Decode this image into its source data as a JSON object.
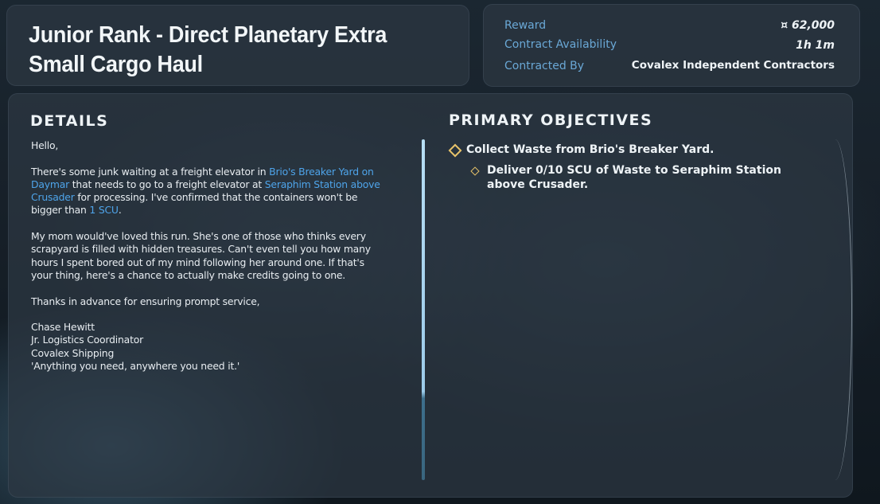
{
  "contract": {
    "title": "Junior Rank - Direct Planetary Extra Small Cargo Haul"
  },
  "info": {
    "reward_label": "Reward",
    "reward_value": "¤ 62,000",
    "availability_label": "Contract Availability",
    "availability_value": "1h 1m",
    "contracted_by_label": "Contracted By",
    "contracted_by_value": "Covalex Independent Contractors"
  },
  "details": {
    "heading": "DETAILS",
    "greeting": "Hello,",
    "p1_a": "There's some junk waiting at a freight elevator in ",
    "p1_link1": "Brio's Breaker Yard on Daymar",
    "p1_b": " that needs to go to a freight elevator at ",
    "p1_link2": "Seraphim Station above Crusader",
    "p1_c": " for processing. I've confirmed that the containers won't be bigger than ",
    "p1_link3": "1 SCU",
    "p1_d": ".",
    "p2": "My mom would've loved this run. She's one of those who thinks every scrapyard is filled with hidden treasures. Can't even tell you how many hours I spent bored out of my mind following her around one. If that's your thing, here's a chance to actually make credits going to one.",
    "p3": "Thanks in advance for ensuring prompt service,",
    "sig_name": "Chase Hewitt",
    "sig_role": "Jr. Logistics Coordinator",
    "sig_company": "Covalex Shipping",
    "sig_motto": "'Anything you need, anywhere you need it.'"
  },
  "objectives": {
    "heading": "PRIMARY OBJECTIVES",
    "items": [
      {
        "text": "Collect Waste from Brio's Breaker Yard."
      },
      {
        "text": "Deliver 0/10 SCU of Waste to Seraphim Station above Crusader."
      }
    ]
  },
  "colors": {
    "accent_link": "#4ea4ea",
    "label_blue": "#6aa8d6",
    "objective_marker": "#e8c36a"
  },
  "icons": {
    "currency": "currency-icon",
    "objective_marker": "diamond-icon"
  }
}
